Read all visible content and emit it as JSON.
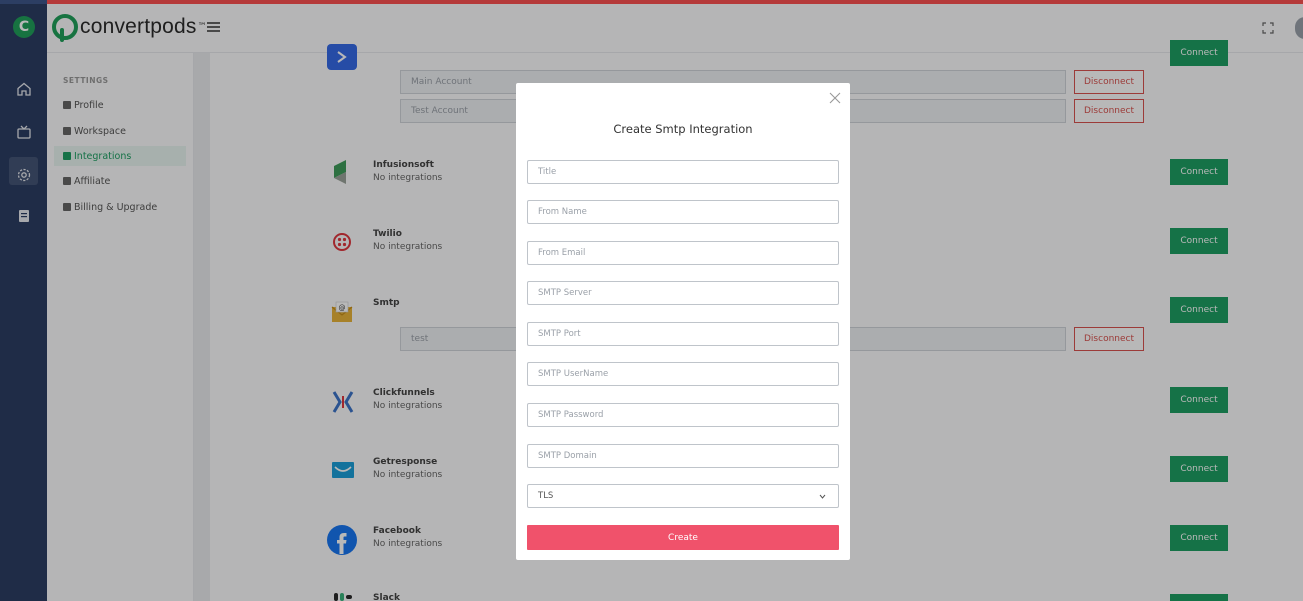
{
  "brand": {
    "name": "convertpods",
    "tm": "™"
  },
  "rail": {
    "logo_letter": "C",
    "items": [
      "home-icon",
      "tv-icon",
      "gear-icon",
      "book-icon"
    ],
    "active": "gear-icon"
  },
  "settings": {
    "title": "SETTINGS",
    "items": [
      {
        "label": "Profile",
        "icon": "user-icon"
      },
      {
        "label": "Workspace",
        "icon": "building-icon"
      },
      {
        "label": "Integrations",
        "icon": "puzzle-icon",
        "active": true
      },
      {
        "label": "Affiliate",
        "icon": "sitemap-icon"
      },
      {
        "label": "Billing & Upgrade",
        "icon": "money-icon"
      }
    ]
  },
  "integrations": {
    "connect_label": "Connect",
    "disconnect_label": "Disconnect",
    "top": {
      "accounts": [
        "Main Account",
        "Test Account"
      ]
    },
    "items": [
      {
        "name": "Infusionsoft",
        "status": "No integrations"
      },
      {
        "name": "Twilio",
        "status": "No integrations"
      },
      {
        "name": "Smtp",
        "status": "",
        "accounts": [
          "test"
        ]
      },
      {
        "name": "Clickfunnels",
        "status": "No integrations"
      },
      {
        "name": "Getresponse",
        "status": "No integrations"
      },
      {
        "name": "Facebook",
        "status": "No integrations"
      },
      {
        "name": "Slack",
        "status": ""
      }
    ]
  },
  "modal": {
    "title": "Create Smtp Integration",
    "fields": [
      {
        "placeholder": "Title"
      },
      {
        "placeholder": "From Name"
      },
      {
        "placeholder": "From Email"
      },
      {
        "placeholder": "SMTP Server"
      },
      {
        "placeholder": "SMTP Port"
      },
      {
        "placeholder": "SMTP UserName"
      },
      {
        "placeholder": "SMTP Password"
      },
      {
        "placeholder": "SMTP Domain"
      }
    ],
    "select_value": "TLS",
    "submit_label": "Create"
  },
  "colors": {
    "accent_green": "#1e9e63",
    "create_button": "#f0526b",
    "rail_bg": "#2c3e63",
    "danger": "#d9534f"
  }
}
